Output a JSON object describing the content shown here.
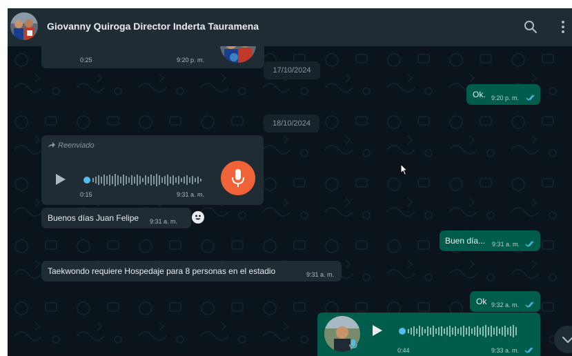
{
  "colors": {
    "header_bg": "#202c33",
    "chat_bg": "#0b141a",
    "incoming_bubble": "#202c33",
    "outgoing_bubble": "#005c4b",
    "mic_button": "#f06238",
    "read_ticks": "#53bdeb"
  },
  "header": {
    "contact_name": "Giovanny Quiroga Director Inderta Tauramena",
    "icons": [
      "avatar",
      "search-icon",
      "menu-dots-icon"
    ]
  },
  "messages": {
    "top_voice": {
      "duration": "0:25",
      "time": "9:20 p. m."
    },
    "date_1": "17/10/2024",
    "ok_1": {
      "text": "Ok.",
      "time": "9:20 p. m."
    },
    "date_2": "18/10/2024",
    "forwarded_voice": {
      "forwarded_label": "Reenviado",
      "duration": "0:15",
      "time": "9:31 a. m."
    },
    "buenos_dias": {
      "text": "Buenos días Juan Felipe",
      "time": "9:31 a. m."
    },
    "buen_dia": {
      "text": "Buen día...",
      "time": "9:31 a. m."
    },
    "taekwondo": {
      "text": "Taekwondo requiere Hospedaje para 8 personas en el estadio",
      "time": "9:31 a. m."
    },
    "ok_2": {
      "text": "Ok",
      "time": "9:32 a. m."
    },
    "out_voice": {
      "duration": "0:44",
      "time": "9:33 a. m."
    }
  }
}
